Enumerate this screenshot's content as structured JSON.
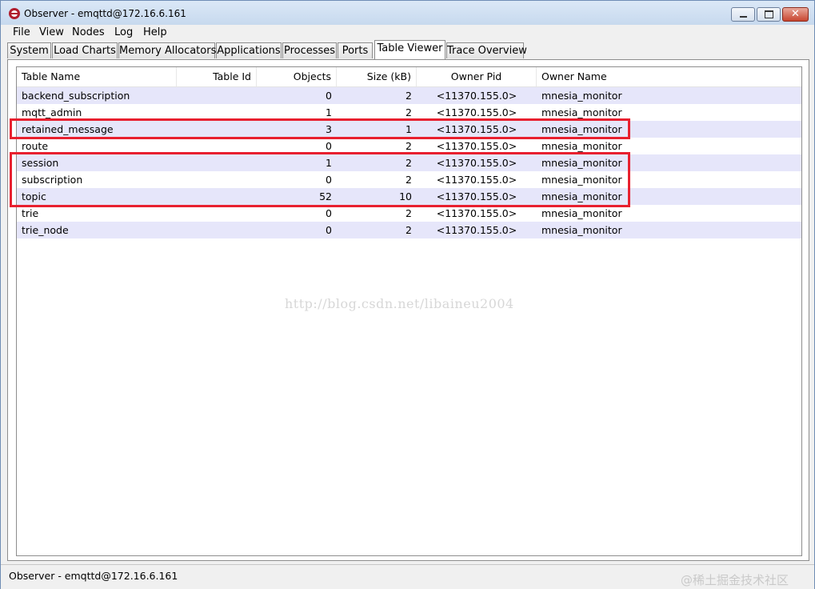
{
  "window": {
    "title": "Observer - emqttd@172.16.6.161",
    "buttons": {
      "minimize": "minimize",
      "maximize": "maximize",
      "close": "close"
    }
  },
  "menu": [
    "File",
    "View",
    "Nodes",
    "Log",
    "Help"
  ],
  "tabs": [
    {
      "label": "System",
      "active": false
    },
    {
      "label": "Load Charts",
      "active": false
    },
    {
      "label": "Memory Allocators",
      "active": false
    },
    {
      "label": "Applications",
      "active": false
    },
    {
      "label": "Processes",
      "active": false
    },
    {
      "label": "Ports",
      "active": false
    },
    {
      "label": "Table Viewer",
      "active": true
    },
    {
      "label": "Trace Overview",
      "active": false
    }
  ],
  "table": {
    "columns": [
      "Table Name",
      "Table Id",
      "Objects",
      "Size (kB)",
      "Owner Pid",
      "Owner Name"
    ],
    "rows": [
      {
        "name": "backend_subscription",
        "id": "",
        "objects": "0",
        "size": "2",
        "pid": "<11370.155.0>",
        "owner": "mnesia_monitor"
      },
      {
        "name": "mqtt_admin",
        "id": "",
        "objects": "1",
        "size": "2",
        "pid": "<11370.155.0>",
        "owner": "mnesia_monitor"
      },
      {
        "name": "retained_message",
        "id": "",
        "objects": "3",
        "size": "1",
        "pid": "<11370.155.0>",
        "owner": "mnesia_monitor"
      },
      {
        "name": "route",
        "id": "",
        "objects": "0",
        "size": "2",
        "pid": "<11370.155.0>",
        "owner": "mnesia_monitor"
      },
      {
        "name": "session",
        "id": "",
        "objects": "1",
        "size": "2",
        "pid": "<11370.155.0>",
        "owner": "mnesia_monitor"
      },
      {
        "name": "subscription",
        "id": "",
        "objects": "0",
        "size": "2",
        "pid": "<11370.155.0>",
        "owner": "mnesia_monitor"
      },
      {
        "name": "topic",
        "id": "",
        "objects": "52",
        "size": "10",
        "pid": "<11370.155.0>",
        "owner": "mnesia_monitor"
      },
      {
        "name": "trie",
        "id": "",
        "objects": "0",
        "size": "2",
        "pid": "<11370.155.0>",
        "owner": "mnesia_monitor"
      },
      {
        "name": "trie_node",
        "id": "",
        "objects": "0",
        "size": "2",
        "pid": "<11370.155.0>",
        "owner": "mnesia_monitor"
      }
    ]
  },
  "watermark": "http://blog.csdn.net/libaineu2004",
  "status": {
    "text": "Observer - emqttd@172.16.6.161",
    "corner_watermark": "@稀土掘金技术社区"
  },
  "colors": {
    "highlight": "#e8202f",
    "row_stripe": "#e6e6fa"
  }
}
